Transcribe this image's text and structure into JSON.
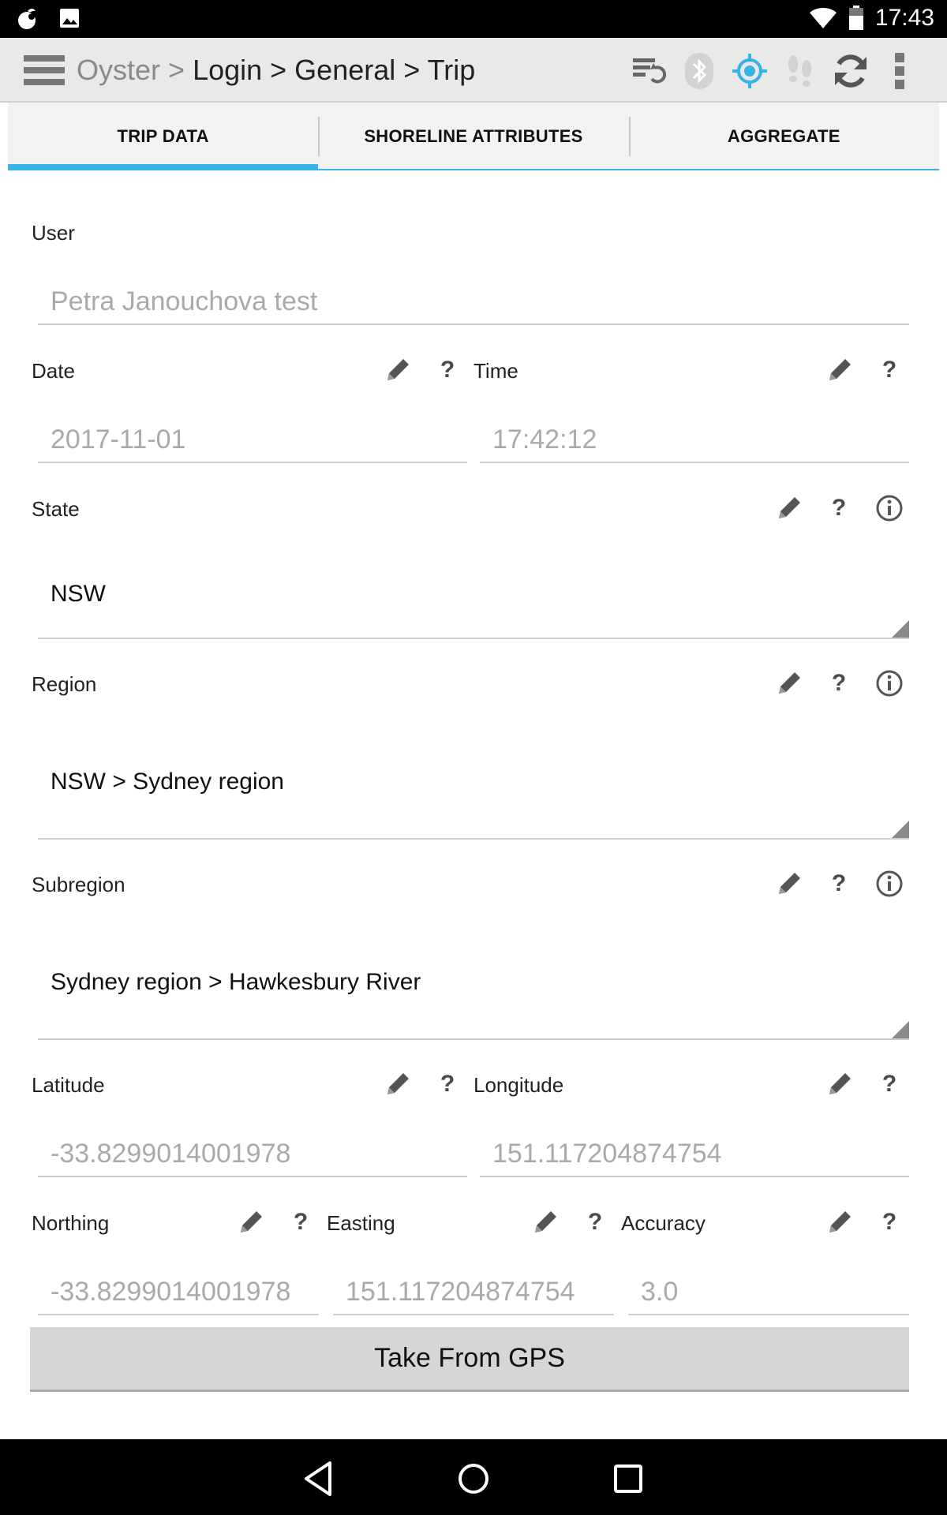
{
  "statusbar": {
    "time": "17:43"
  },
  "actionbar": {
    "breadcrumb_root": "Oyster >",
    "breadcrumb_rest": "Login > General > Trip"
  },
  "tabs": [
    {
      "label": "TRIP DATA",
      "active": true
    },
    {
      "label": "SHORELINE ATTRIBUTES",
      "active": false
    },
    {
      "label": "AGGREGATE",
      "active": false
    }
  ],
  "form": {
    "user": {
      "label": "User",
      "value": "Petra  Janouchova test"
    },
    "date": {
      "label": "Date",
      "value": "2017-11-01"
    },
    "time": {
      "label": "Time",
      "value": "17:42:12"
    },
    "state": {
      "label": "State",
      "value": "NSW"
    },
    "region": {
      "label": "Region",
      "value": "NSW > Sydney region"
    },
    "subregion": {
      "label": "Subregion",
      "value": "Sydney region > Hawkesbury River"
    },
    "latitude": {
      "label": "Latitude",
      "value": "-33.8299014001978"
    },
    "longitude": {
      "label": "Longitude",
      "value": "151.117204874754"
    },
    "northing": {
      "label": "Northing",
      "value": "-33.8299014001978"
    },
    "easting": {
      "label": "Easting",
      "value": "151.117204874754"
    },
    "accuracy": {
      "label": "Accuracy",
      "value": "3.0"
    },
    "help_glyph": "?",
    "gps_button": "Take From GPS"
  },
  "colors": {
    "accent": "#38b3e6",
    "actionbar": "#e9e9e9",
    "button": "#d6d6d6"
  }
}
